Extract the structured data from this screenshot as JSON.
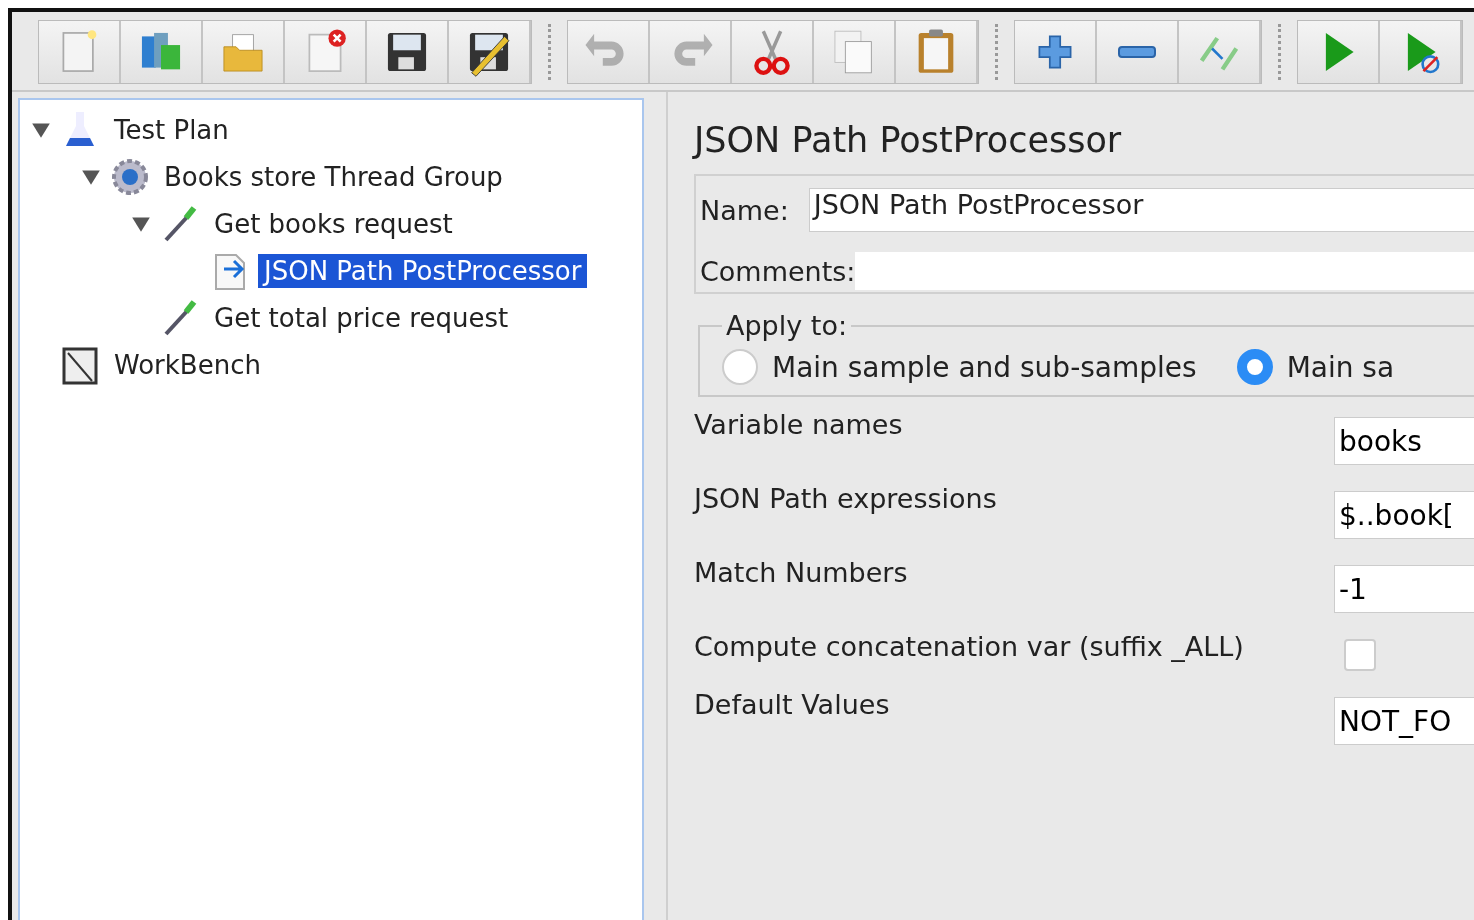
{
  "toolbar": [
    [
      {
        "kind": "new",
        "disabled": false
      },
      {
        "kind": "templates",
        "disabled": false
      },
      {
        "kind": "open",
        "disabled": false
      },
      {
        "kind": "close",
        "disabled": false
      },
      {
        "kind": "save",
        "disabled": false
      },
      {
        "kind": "save-as",
        "disabled": false
      }
    ],
    [
      {
        "kind": "undo",
        "disabled": true
      },
      {
        "kind": "redo",
        "disabled": true
      },
      {
        "kind": "cut",
        "disabled": false
      },
      {
        "kind": "copy",
        "disabled": false
      },
      {
        "kind": "paste",
        "disabled": false
      }
    ],
    [
      {
        "kind": "expand",
        "disabled": false
      },
      {
        "kind": "collapse",
        "disabled": false
      },
      {
        "kind": "toggle",
        "disabled": false
      }
    ],
    [
      {
        "kind": "start",
        "disabled": false
      },
      {
        "kind": "start-no-timers",
        "disabled": false
      }
    ]
  ],
  "tree": [
    {
      "label": "Test Plan",
      "kind": "plan",
      "expanded": true,
      "selected": false,
      "children": [
        {
          "label": "Books store Thread Group",
          "kind": "thread-group",
          "expanded": true,
          "selected": false,
          "children": [
            {
              "label": "Get books request",
              "kind": "sampler",
              "expanded": true,
              "selected": false,
              "children": [
                {
                  "label": "JSON Path PostProcessor",
                  "kind": "postprocessor",
                  "selected": true
                }
              ]
            },
            {
              "label": "Get total price request",
              "kind": "sampler",
              "selected": false
            }
          ]
        }
      ]
    },
    {
      "label": "WorkBench",
      "kind": "workbench",
      "selected": false
    }
  ],
  "panel": {
    "title": "JSON Path PostProcessor",
    "name": {
      "label": "Name:",
      "value": "JSON Path PostProcessor"
    },
    "comments": {
      "label": "Comments:"
    },
    "apply_to": {
      "legend": "Apply to:",
      "options": [
        {
          "label": "Main sample and sub-samples",
          "selected": false
        },
        {
          "label": "Main sa",
          "selected": true
        }
      ]
    },
    "fields": [
      {
        "kind": "text",
        "label": "Variable names",
        "value": "books"
      },
      {
        "kind": "text",
        "label": "JSON Path expressions",
        "value": "$..book["
      },
      {
        "kind": "text",
        "label": "Match Numbers",
        "value": "-1"
      },
      {
        "kind": "checkbox",
        "label": "Compute concatenation var (suffix _ALL)",
        "checked": false
      },
      {
        "kind": "text",
        "label": "Default Values",
        "value": "NOT_FO"
      }
    ]
  }
}
